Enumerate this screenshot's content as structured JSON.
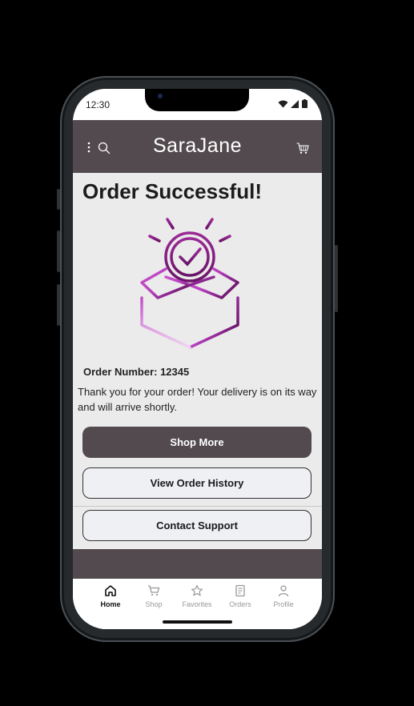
{
  "status_bar": {
    "time": "12:30"
  },
  "header": {
    "brand": "SaraJane"
  },
  "main": {
    "title": "Order Successful!",
    "order_number": "Order Number: 12345",
    "message": "Thank you for your order! Your delivery is on its way and will arrive shortly.",
    "buttons": {
      "shop_more": "Shop More",
      "order_history": "View Order History",
      "contact_support": "Contact Support"
    }
  },
  "tabs": [
    {
      "label": "Home",
      "icon": "home-icon",
      "active": true
    },
    {
      "label": "Shop",
      "icon": "cart-icon"
    },
    {
      "label": "Favorites",
      "icon": "star-icon"
    },
    {
      "label": "Orders",
      "icon": "receipt-icon"
    },
    {
      "label": "Profile",
      "icon": "person-icon"
    }
  ],
  "colors": {
    "brand": "#524a4e",
    "accent_start": "#cc55cc",
    "accent_end": "#6a1468",
    "background": "#ebebeb"
  }
}
